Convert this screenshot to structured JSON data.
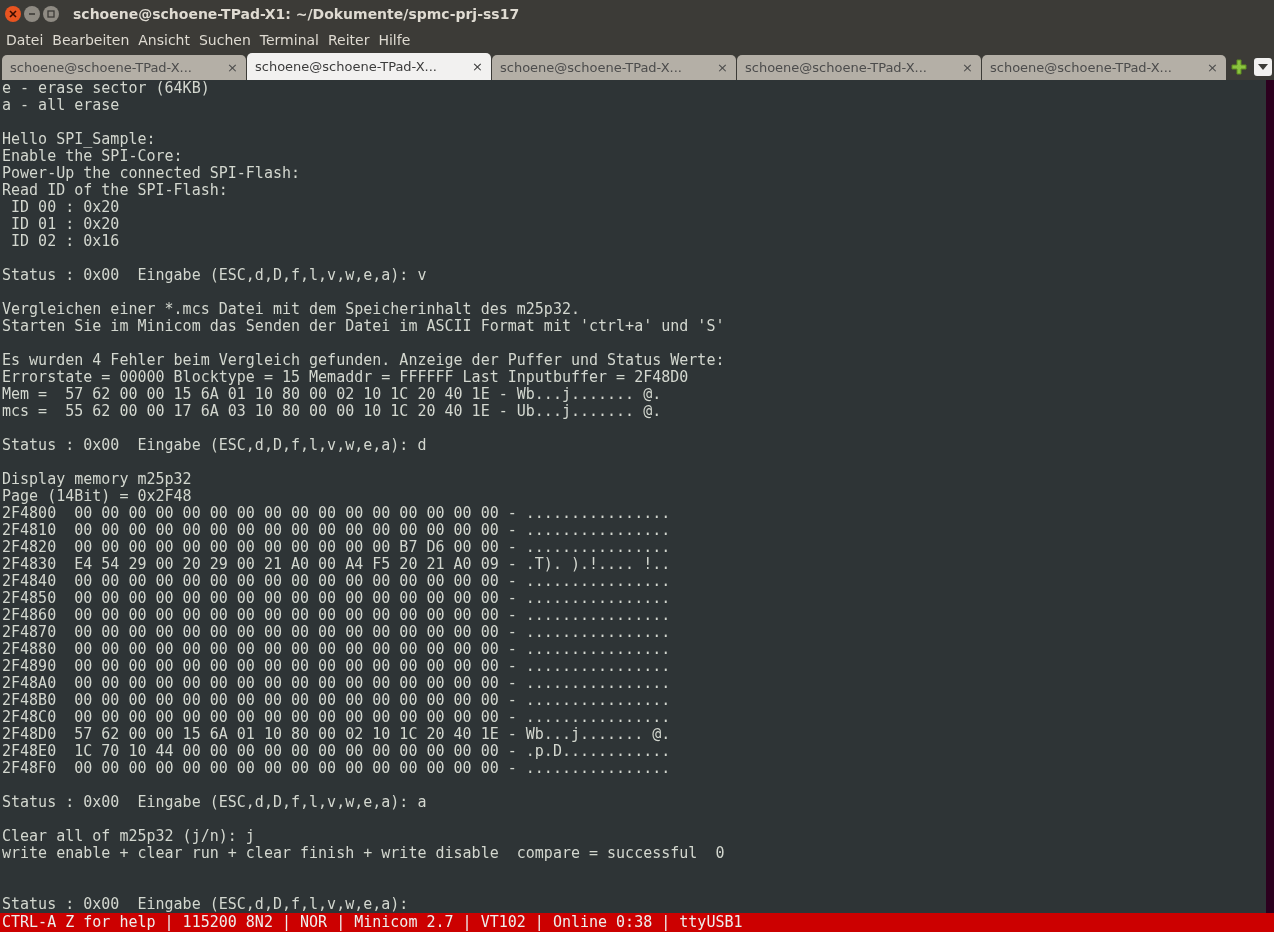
{
  "window": {
    "title": "schoene@schoene-TPad-X1: ~/Dokumente/spmc-prj-ss17"
  },
  "menu": [
    "Datei",
    "Bearbeiten",
    "Ansicht",
    "Suchen",
    "Terminal",
    "Reiter",
    "Hilfe"
  ],
  "tabs": [
    {
      "label": "schoene@schoene-TPad-X...",
      "close": "×",
      "selected": false
    },
    {
      "label": "schoene@schoene-TPad-X...",
      "close": "×",
      "selected": true
    },
    {
      "label": "schoene@schoene-TPad-X...",
      "close": "×",
      "selected": false
    },
    {
      "label": "schoene@schoene-TPad-X...",
      "close": "×",
      "selected": false
    },
    {
      "label": "schoene@schoene-TPad-X...",
      "close": "×",
      "selected": false
    }
  ],
  "terminal": {
    "blocks": [
      [
        "e - erase sector (64KB)",
        "a - all erase"
      ],
      [
        "Hello SPI_Sample:",
        "Enable the SPI-Core:",
        "Power-Up the connected SPI-Flash:",
        "Read ID of the SPI-Flash:",
        " ID 00 : 0x20",
        " ID 01 : 0x20",
        " ID 02 : 0x16"
      ],
      [
        "Status : 0x00  Eingabe (ESC,d,D,f,l,v,w,e,a): v"
      ],
      [
        "Vergleichen einer *.mcs Datei mit dem Speicherinhalt des m25p32.",
        "Starten Sie im Minicom das Senden der Datei im ASCII Format mit 'ctrl+a' und 'S'"
      ],
      [
        "Es wurden 4 Fehler beim Vergleich gefunden. Anzeige der Puffer und Status Werte:",
        "Errorstate = 00000 Blocktype = 15 Memaddr = FFFFFF Last Inputbuffer = 2F48D0",
        "Mem =  57 62 00 00 15 6A 01 10 80 00 02 10 1C 20 40 1E - Wb...j....... @.",
        "mcs =  55 62 00 00 17 6A 03 10 80 00 00 10 1C 20 40 1E - Ub...j....... @."
      ],
      [
        "Status : 0x00  Eingabe (ESC,d,D,f,l,v,w,e,a): d"
      ],
      [
        "Display memory m25p32",
        "Page (14Bit) = 0x2F48",
        "2F4800  00 00 00 00 00 00 00 00 00 00 00 00 00 00 00 00 - ................",
        "2F4810  00 00 00 00 00 00 00 00 00 00 00 00 00 00 00 00 - ................",
        "2F4820  00 00 00 00 00 00 00 00 00 00 00 00 B7 D6 00 00 - ................",
        "2F4830  E4 54 29 00 20 29 00 21 A0 00 A4 F5 20 21 A0 09 - .T). ).!.... !..",
        "2F4840  00 00 00 00 00 00 00 00 00 00 00 00 00 00 00 00 - ................",
        "2F4850  00 00 00 00 00 00 00 00 00 00 00 00 00 00 00 00 - ................",
        "2F4860  00 00 00 00 00 00 00 00 00 00 00 00 00 00 00 00 - ................",
        "2F4870  00 00 00 00 00 00 00 00 00 00 00 00 00 00 00 00 - ................",
        "2F4880  00 00 00 00 00 00 00 00 00 00 00 00 00 00 00 00 - ................",
        "2F4890  00 00 00 00 00 00 00 00 00 00 00 00 00 00 00 00 - ................",
        "2F48A0  00 00 00 00 00 00 00 00 00 00 00 00 00 00 00 00 - ................",
        "2F48B0  00 00 00 00 00 00 00 00 00 00 00 00 00 00 00 00 - ................",
        "2F48C0  00 00 00 00 00 00 00 00 00 00 00 00 00 00 00 00 - ................",
        "2F48D0  57 62 00 00 15 6A 01 10 80 00 02 10 1C 20 40 1E - Wb...j....... @.",
        "2F48E0  1C 70 10 44 00 00 00 00 00 00 00 00 00 00 00 00 - .p.D............",
        "2F48F0  00 00 00 00 00 00 00 00 00 00 00 00 00 00 00 00 - ................"
      ],
      [
        "Status : 0x00  Eingabe (ESC,d,D,f,l,v,w,e,a): a"
      ],
      [
        "Clear all of m25p32 (j/n): j",
        "write enable + clear run + clear finish + write disable  compare = successful  0"
      ],
      [
        "Status : 0x00  Eingabe (ESC,d,D,f,l,v,w,e,a):"
      ]
    ]
  },
  "status_bar": "CTRL-A Z for help | 115200 8N2 | NOR | Minicom 2.7 | VT102 | Online 0:38 | ttyUSB1"
}
